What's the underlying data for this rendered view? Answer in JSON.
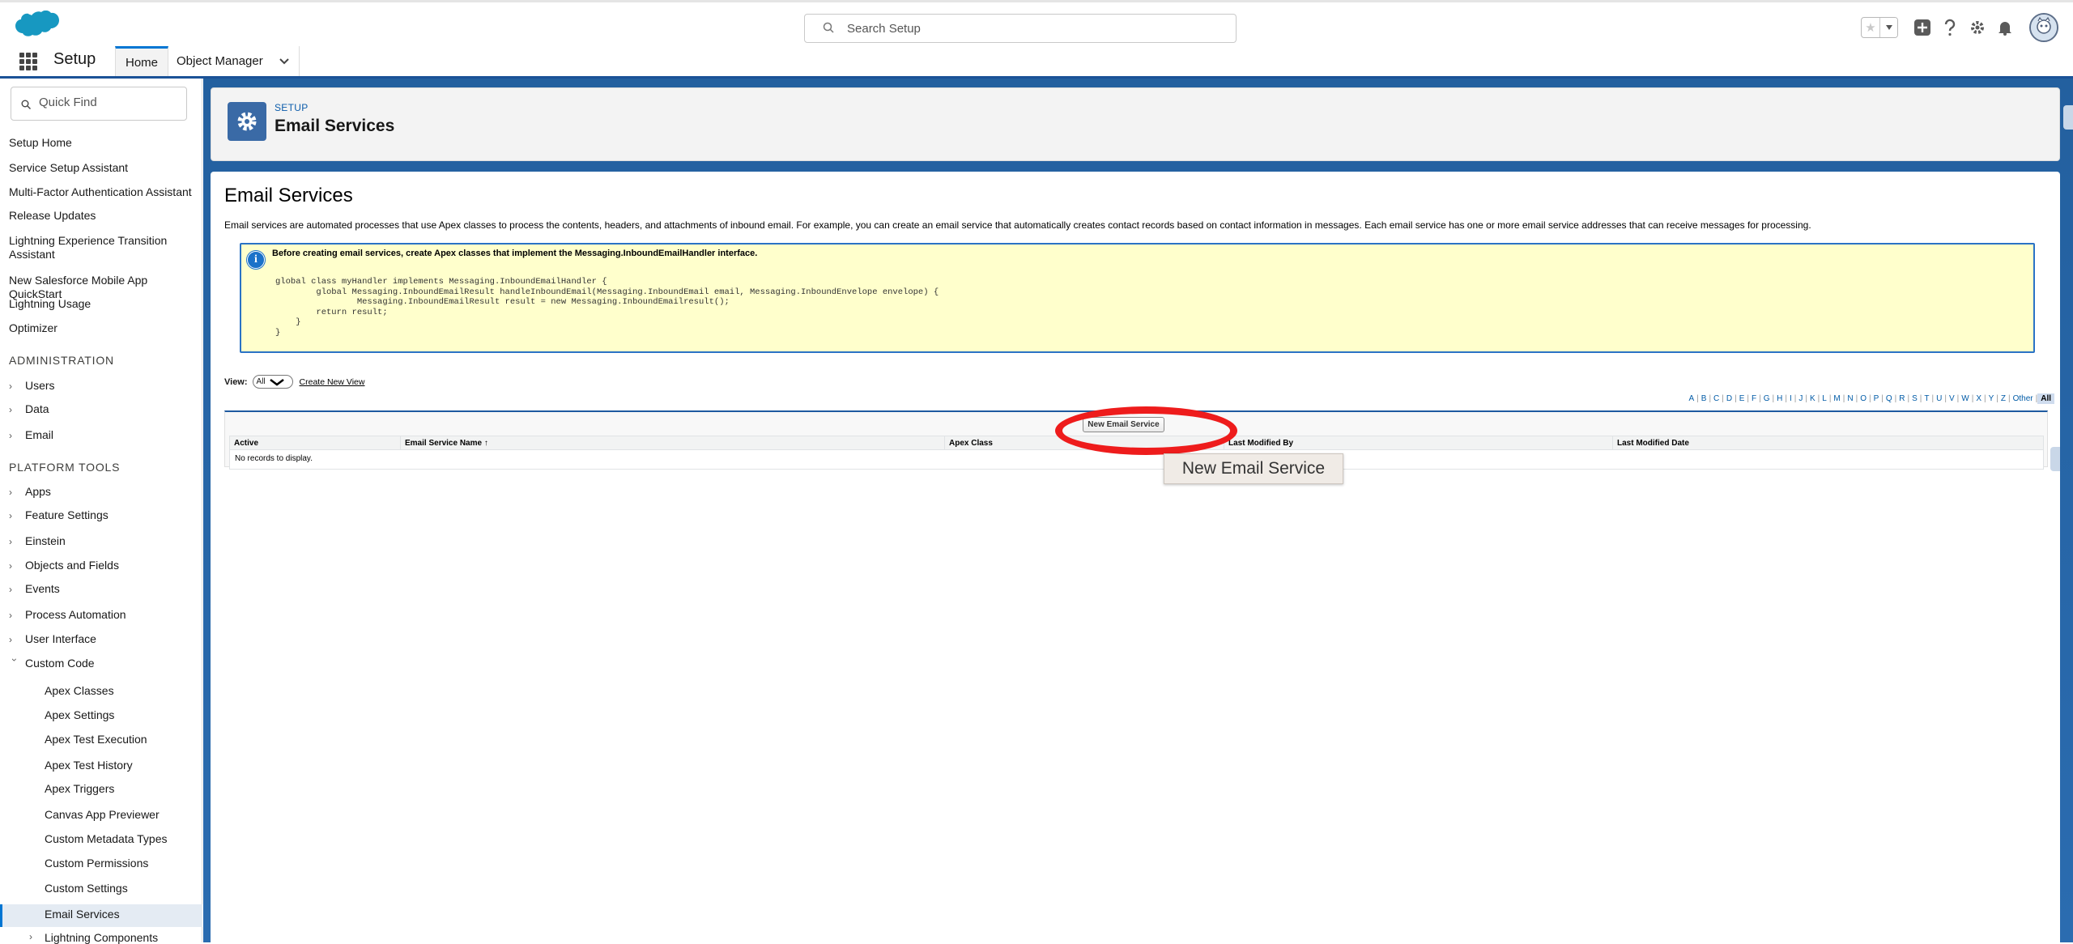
{
  "header": {
    "search_placeholder": "Search Setup"
  },
  "context_bar": {
    "app_name": "Setup",
    "tabs": [
      {
        "label": "Home"
      },
      {
        "label": "Object Manager"
      }
    ]
  },
  "sidebar": {
    "quick_find_placeholder": "Quick Find",
    "top_items": [
      "Setup Home",
      "Service Setup Assistant",
      "Multi-Factor Authentication Assistant",
      "Release Updates",
      "Lightning Experience Transition Assistant",
      "New Salesforce Mobile App QuickStart",
      "Lightning Usage",
      "Optimizer"
    ],
    "admin_heading": "ADMINISTRATION",
    "admin_items": [
      "Users",
      "Data",
      "Email"
    ],
    "platform_heading": "PLATFORM TOOLS",
    "platform_items": [
      "Apps",
      "Feature Settings",
      "Einstein",
      "Objects and Fields",
      "Events",
      "Process Automation",
      "User Interface",
      "Custom Code"
    ],
    "custom_code_items": [
      "Apex Classes",
      "Apex Settings",
      "Apex Test Execution",
      "Apex Test History",
      "Apex Triggers",
      "Canvas App Previewer",
      "Custom Metadata Types",
      "Custom Permissions",
      "Custom Settings",
      "Email Services",
      "Lightning Components"
    ],
    "selected_item": "Email Services"
  },
  "page_header": {
    "breadcrumb": "SETUP",
    "title": "Email Services"
  },
  "content": {
    "heading": "Email Services",
    "description": "Email services are automated processes that use Apex classes to process the contents, headers, and attachments of inbound email. For example, you can create an email service that automatically creates contact records based on contact information in messages. Each email service has one or more email service addresses that can receive messages for processing.",
    "info_title": "Before creating email services, create Apex classes that implement the Messaging.InboundEmailHandler interface.",
    "code_sample": "global class myHandler implements Messaging.InboundEmailHandler {\n        global Messaging.InboundEmailResult handleInboundEmail(Messaging.InboundEmail email, Messaging.InboundEnvelope envelope) {\n                Messaging.InboundEmailResult result = new Messaging.InboundEmailresult();\n        return result;\n    }\n}",
    "view_label": "View:",
    "view_value": "All",
    "create_view_link": "Create New View",
    "alphabet": [
      "A",
      "B",
      "C",
      "D",
      "E",
      "F",
      "G",
      "H",
      "I",
      "J",
      "K",
      "L",
      "M",
      "N",
      "O",
      "P",
      "Q",
      "R",
      "S",
      "T",
      "U",
      "V",
      "W",
      "X",
      "Y",
      "Z",
      "Other",
      "All"
    ],
    "new_button": "New Email Service",
    "columns": [
      "Active",
      "Email Service Name ↑",
      "Apex Class",
      "Last Modified By",
      "Last Modified Date"
    ],
    "empty_message": "No records to display.",
    "tooltip": "New Email Service"
  },
  "colors": {
    "brand_blue": "#0176d3",
    "highlight_red": "#ee1c1c",
    "info_bg": "#ffffcc"
  }
}
